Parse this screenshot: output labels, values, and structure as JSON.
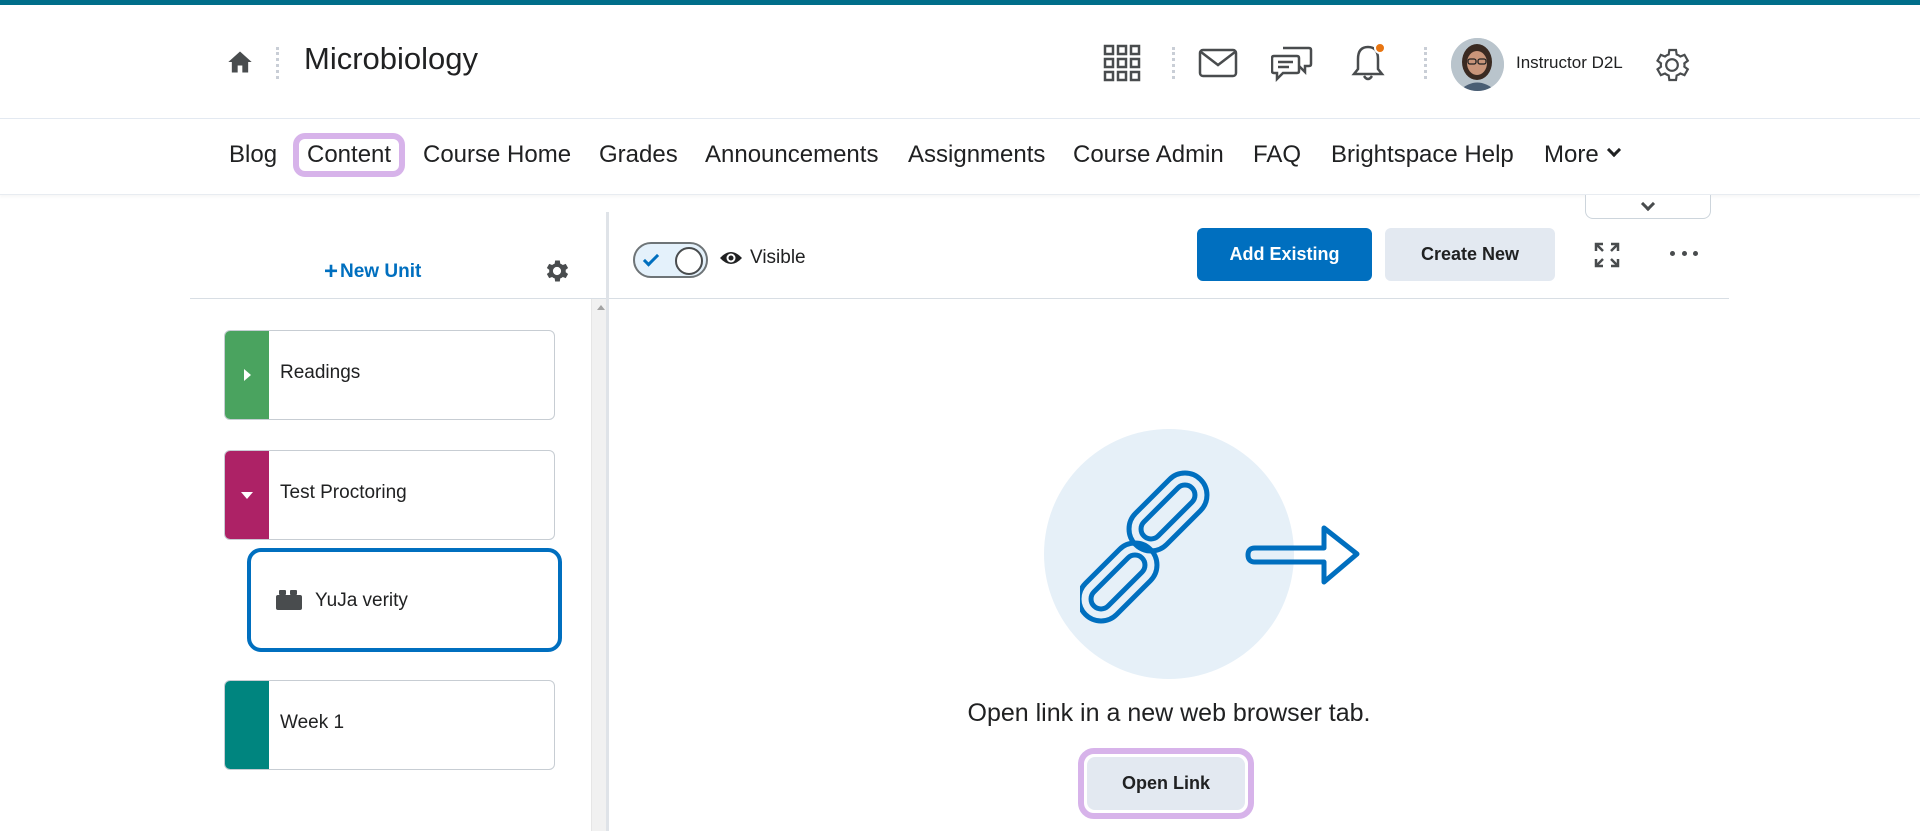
{
  "header": {
    "course_title": "Microbiology",
    "user_name": "Instructor D2L",
    "icons": [
      "home-icon",
      "apps-grid-icon",
      "mail-icon",
      "chat-icon",
      "bell-icon",
      "settings-gear-icon"
    ],
    "notification_color": "#e87511"
  },
  "nav": {
    "items": [
      {
        "label": "Blog"
      },
      {
        "label": "Content"
      },
      {
        "label": "Course Home"
      },
      {
        "label": "Grades"
      },
      {
        "label": "Announcements"
      },
      {
        "label": "Assignments"
      },
      {
        "label": "Course Admin"
      },
      {
        "label": "FAQ"
      },
      {
        "label": "Brightspace Help"
      },
      {
        "label": "More"
      }
    ],
    "active": "Content",
    "highlight_color": "#d7b3ea"
  },
  "left_panel": {
    "new_unit_label": "New Unit",
    "units": [
      {
        "label": "Readings",
        "color": "#4aa35f",
        "state": "collapsed"
      },
      {
        "label": "Test Proctoring",
        "color": "#ad2266",
        "state": "expanded"
      },
      {
        "label": "Week 1",
        "color": "#00857f",
        "state": "none"
      }
    ],
    "selected_topic": {
      "label": "YuJa verity",
      "icon": "lego-brick-icon"
    }
  },
  "toolbar": {
    "visibility_label": "Visible",
    "visibility_on": true,
    "add_existing_label": "Add Existing",
    "create_new_label": "Create New",
    "primary_color": "#006fbf"
  },
  "main": {
    "message": "Open link in a new web browser tab.",
    "open_link_label": "Open Link",
    "illustration": "chain-link-arrow-icon"
  }
}
